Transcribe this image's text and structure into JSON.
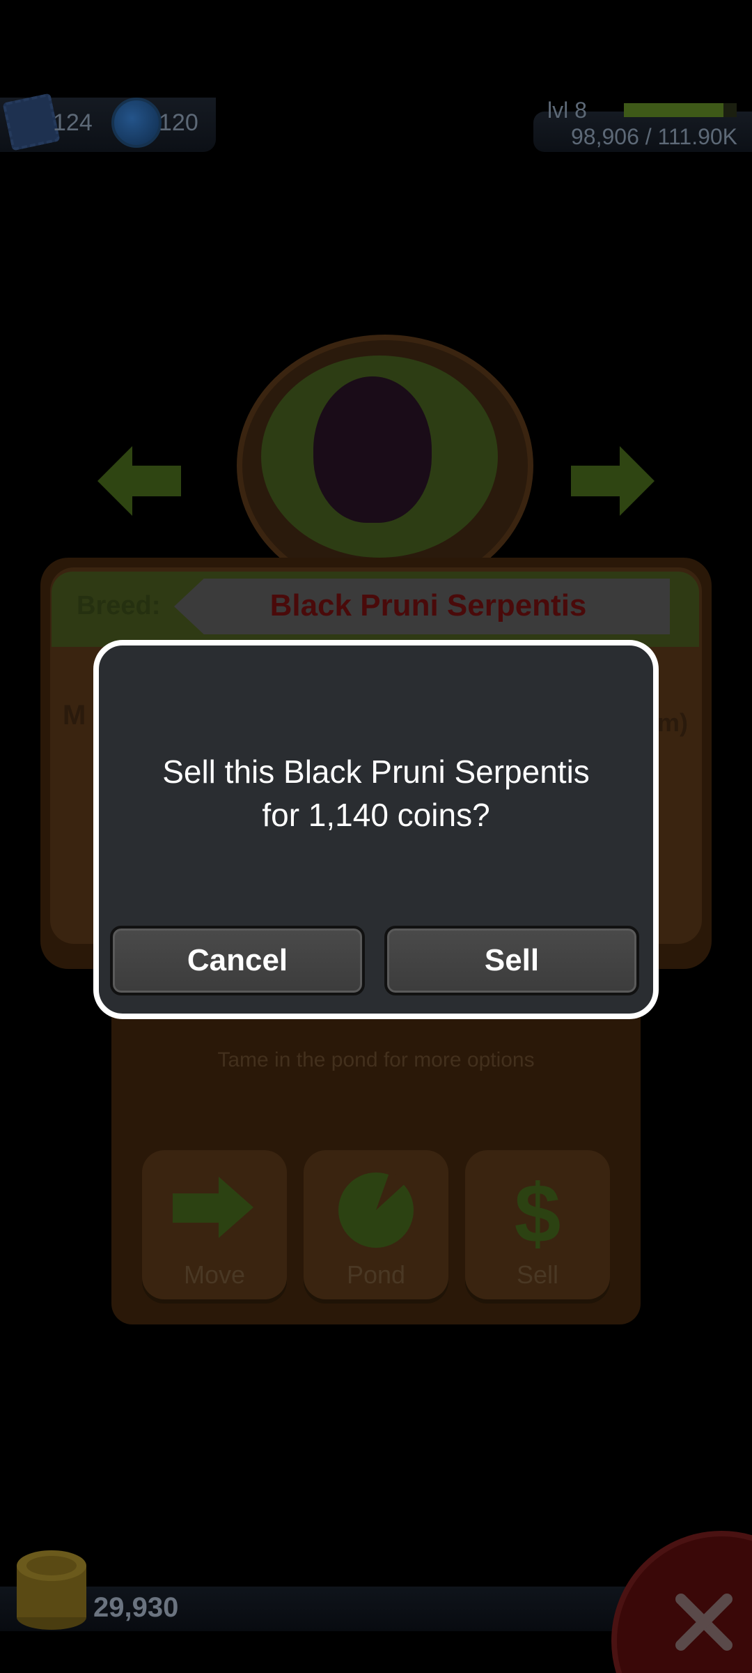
{
  "hud": {
    "stamps_count": "124",
    "potions_count": "120",
    "level_label": "lvl 8",
    "xp_text": "98,906 / 111.90K",
    "xp_progress": 0.88
  },
  "frog_card": {
    "breed_label": "Breed:",
    "breed_name": "Black Pruni Serpentis",
    "left_partial": "M",
    "right_partial": "m)"
  },
  "actions": {
    "hint": "Tame in the pond for more options",
    "move_label": "Move",
    "pond_label": "Pond",
    "sell_label": "Sell"
  },
  "footer": {
    "coins": "29,930"
  },
  "dialog": {
    "message_line1": "Sell this Black Pruni Serpentis",
    "message_line2": "for 1,140 coins?",
    "cancel_label": "Cancel",
    "sell_label": "Sell"
  },
  "colors": {
    "dialog_bg": "#2a2d31",
    "dialog_border": "#ffffff",
    "button_bg": "#444444"
  }
}
